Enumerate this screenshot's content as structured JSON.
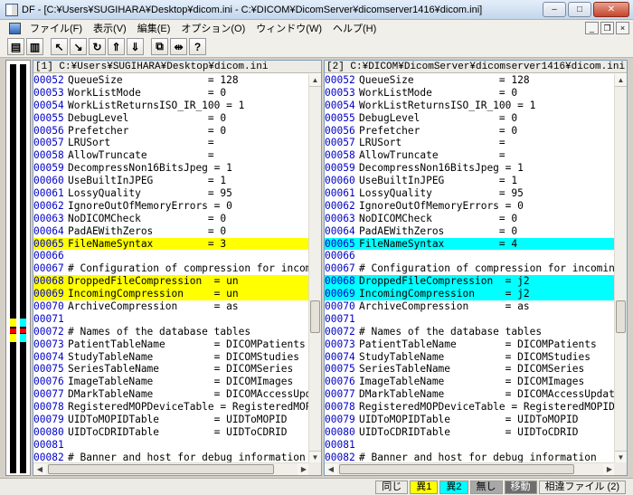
{
  "window": {
    "title": "DF - [C:¥Users¥SUGIHARA¥Desktop¥dicom.ini - C:¥DICOM¥DicomServer¥dicomserver1416¥dicom.ini]",
    "min_label": "–",
    "max_label": "□",
    "close_label": "✕"
  },
  "menu": {
    "items": [
      "ファイル(F)",
      "表示(V)",
      "編集(E)",
      "オプション(O)",
      "ウィンドウ(W)",
      "ヘルプ(H)"
    ],
    "mdi_min": "_",
    "mdi_restore": "❐",
    "mdi_close": "×"
  },
  "toolbar": {
    "buttons": [
      {
        "icon": "open-file-icon",
        "glyph": "▤"
      },
      {
        "icon": "open-folder-icon",
        "glyph": "▥"
      },
      {
        "icon": "prev-diff-icon",
        "glyph": "↖"
      },
      {
        "icon": "next-diff-icon",
        "glyph": "↘"
      },
      {
        "icon": "refresh-icon",
        "glyph": "↻"
      },
      {
        "icon": "first-diff-icon",
        "glyph": "⇑"
      },
      {
        "icon": "last-diff-icon",
        "glyph": "⇓"
      },
      {
        "icon": "copy-icon",
        "glyph": "⧉"
      },
      {
        "icon": "split-icon",
        "glyph": "⇹"
      },
      {
        "icon": "help-icon",
        "glyph": "?"
      }
    ]
  },
  "colors": {
    "diff1": "#ffff00",
    "diff2": "#00ffff",
    "line_number": "#0000c8"
  },
  "left": {
    "header": "[1] C:¥Users¥SUGIHARA¥Desktop¥dicom.ini",
    "lines": [
      {
        "n": "00052",
        "t": "QueueSize              = 128",
        "d": ""
      },
      {
        "n": "00053",
        "t": "WorkListMode           = 0",
        "d": ""
      },
      {
        "n": "00054",
        "t": "WorkListReturnsISO_IR_100 = 1",
        "d": ""
      },
      {
        "n": "00055",
        "t": "DebugLevel             = 0",
        "d": ""
      },
      {
        "n": "00056",
        "t": "Prefetcher             = 0",
        "d": ""
      },
      {
        "n": "00057",
        "t": "LRUSort                =",
        "d": ""
      },
      {
        "n": "00058",
        "t": "AllowTruncate          =",
        "d": ""
      },
      {
        "n": "00059",
        "t": "DecompressNon16BitsJpeg = 1",
        "d": ""
      },
      {
        "n": "00060",
        "t": "UseBuiltInJPEG         = 1",
        "d": ""
      },
      {
        "n": "00061",
        "t": "LossyQuality           = 95",
        "d": ""
      },
      {
        "n": "00062",
        "t": "IgnoreOutOfMemoryErrors = 0",
        "d": ""
      },
      {
        "n": "00063",
        "t": "NoDICOMCheck           = 0",
        "d": ""
      },
      {
        "n": "00064",
        "t": "PadAEWithZeros         = 0",
        "d": ""
      },
      {
        "n": "00065",
        "t": "FileNameSyntax         = 3",
        "d": "diff1"
      },
      {
        "n": "00066",
        "t": "",
        "d": ""
      },
      {
        "n": "00067",
        "t": "# Configuration of compression for incoming",
        "d": ""
      },
      {
        "n": "00068",
        "t": "DroppedFileCompression  = un",
        "d": "diff1"
      },
      {
        "n": "00069",
        "t": "IncomingCompression     = un",
        "d": "diff1"
      },
      {
        "n": "00070",
        "t": "ArchiveCompression      = as",
        "d": ""
      },
      {
        "n": "00071",
        "t": "",
        "d": ""
      },
      {
        "n": "00072",
        "t": "# Names of the database tables",
        "d": ""
      },
      {
        "n": "00073",
        "t": "PatientTableName        = DICOMPatients",
        "d": ""
      },
      {
        "n": "00074",
        "t": "StudyTableName          = DICOMStudies",
        "d": ""
      },
      {
        "n": "00075",
        "t": "SeriesTableName         = DICOMSeries",
        "d": ""
      },
      {
        "n": "00076",
        "t": "ImageTableName          = DICOMImages",
        "d": ""
      },
      {
        "n": "00077",
        "t": "DMarkTableName          = DICOMAccessUpdat",
        "d": ""
      },
      {
        "n": "00078",
        "t": "RegisteredMOPDeviceTable = RegisteredMOPIDs",
        "d": ""
      },
      {
        "n": "00079",
        "t": "UIDToMOPIDTable         = UIDToMOPID",
        "d": ""
      },
      {
        "n": "00080",
        "t": "UIDToCDRIDTable         = UIDToCDRID",
        "d": ""
      },
      {
        "n": "00081",
        "t": "",
        "d": ""
      },
      {
        "n": "00082",
        "t": "# Banner and host for debug information",
        "d": ""
      }
    ]
  },
  "right": {
    "header": "[2] C:¥DICOM¥DicomServer¥dicomserver1416¥dicom.ini",
    "lines": [
      {
        "n": "00052",
        "t": "QueueSize              = 128",
        "d": ""
      },
      {
        "n": "00053",
        "t": "WorkListMode           = 0",
        "d": ""
      },
      {
        "n": "00054",
        "t": "WorkListReturnsISO_IR_100 = 1",
        "d": ""
      },
      {
        "n": "00055",
        "t": "DebugLevel             = 0",
        "d": ""
      },
      {
        "n": "00056",
        "t": "Prefetcher             = 0",
        "d": ""
      },
      {
        "n": "00057",
        "t": "LRUSort                =",
        "d": ""
      },
      {
        "n": "00058",
        "t": "AllowTruncate          =",
        "d": ""
      },
      {
        "n": "00059",
        "t": "DecompressNon16BitsJpeg = 1",
        "d": ""
      },
      {
        "n": "00060",
        "t": "UseBuiltInJPEG         = 1",
        "d": ""
      },
      {
        "n": "00061",
        "t": "LossyQuality           = 95",
        "d": ""
      },
      {
        "n": "00062",
        "t": "IgnoreOutOfMemoryErrors = 0",
        "d": ""
      },
      {
        "n": "00063",
        "t": "NoDICOMCheck           = 0",
        "d": ""
      },
      {
        "n": "00064",
        "t": "PadAEWithZeros         = 0",
        "d": ""
      },
      {
        "n": "00065",
        "t": "FileNameSyntax         = 4",
        "d": "diff2"
      },
      {
        "n": "00066",
        "t": "",
        "d": ""
      },
      {
        "n": "00067",
        "t": "# Configuration of compression for incoming im",
        "d": ""
      },
      {
        "n": "00068",
        "t": "DroppedFileCompression  = j2",
        "d": "diff2"
      },
      {
        "n": "00069",
        "t": "IncomingCompression     = j2",
        "d": "diff2"
      },
      {
        "n": "00070",
        "t": "ArchiveCompression      = as",
        "d": ""
      },
      {
        "n": "00071",
        "t": "",
        "d": ""
      },
      {
        "n": "00072",
        "t": "# Names of the database tables",
        "d": ""
      },
      {
        "n": "00073",
        "t": "PatientTableName        = DICOMPatients",
        "d": ""
      },
      {
        "n": "00074",
        "t": "StudyTableName          = DICOMStudies",
        "d": ""
      },
      {
        "n": "00075",
        "t": "SeriesTableName         = DICOMSeries",
        "d": ""
      },
      {
        "n": "00076",
        "t": "ImageTableName          = DICOMImages",
        "d": ""
      },
      {
        "n": "00077",
        "t": "DMarkTableName          = DICOMAccessUpdates",
        "d": ""
      },
      {
        "n": "00078",
        "t": "RegisteredMOPDeviceTable = RegisteredMOPIDs",
        "d": ""
      },
      {
        "n": "00079",
        "t": "UIDToMOPIDTable         = UIDToMOPID",
        "d": ""
      },
      {
        "n": "00080",
        "t": "UIDToCDRIDTable         = UIDToCDRID",
        "d": ""
      },
      {
        "n": "00081",
        "t": "",
        "d": ""
      },
      {
        "n": "00082",
        "t": "# Banner and host for debug information",
        "d": ""
      }
    ]
  },
  "status": {
    "same": "同じ",
    "diff1": "異1",
    "diff2": "異2",
    "none": "無し",
    "moved": "移動",
    "similar": "相違ファイル (2)"
  }
}
